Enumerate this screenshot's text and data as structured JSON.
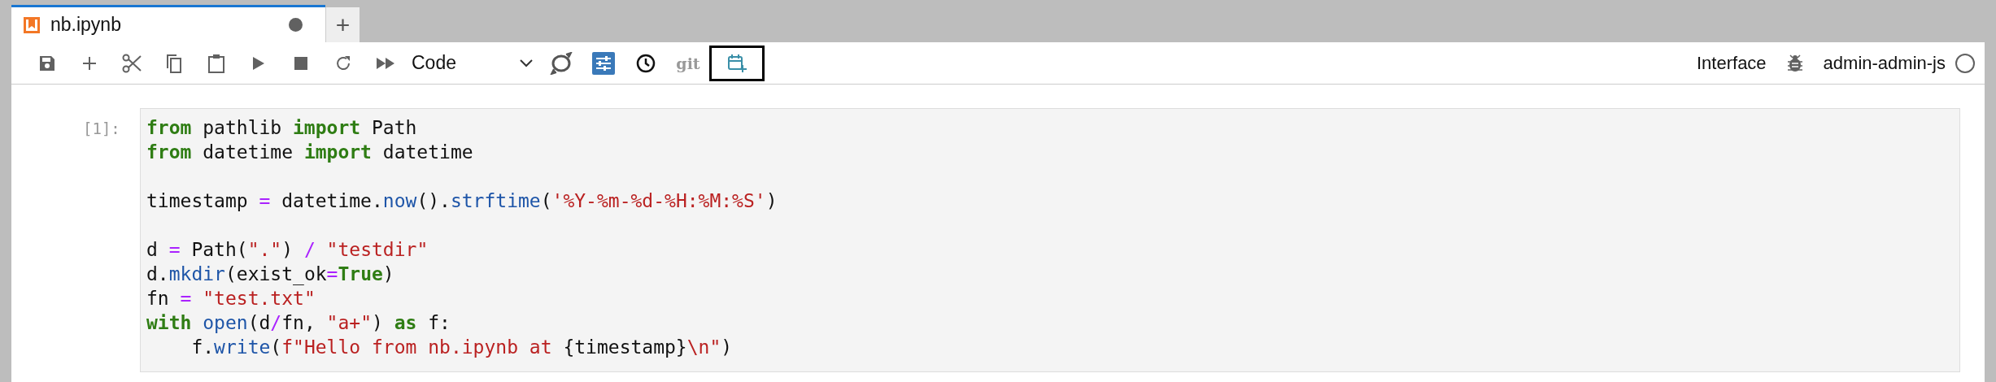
{
  "tabs": [
    {
      "title": "nb.ipynb",
      "modified": true,
      "selected": true
    }
  ],
  "new_tab_button": "+",
  "toolbar": {
    "buttons": [
      {
        "kind": "save",
        "selected": false
      },
      {
        "kind": "insert",
        "selected": false
      },
      {
        "kind": "cut",
        "selected": false
      },
      {
        "kind": "copy",
        "selected": false
      },
      {
        "kind": "paste",
        "selected": false
      },
      {
        "kind": "run",
        "selected": false
      },
      {
        "kind": "stop",
        "selected": false
      },
      {
        "kind": "restart",
        "selected": false
      },
      {
        "kind": "run-all",
        "selected": false
      }
    ],
    "cell_type": "Code",
    "extra_buttons": [
      {
        "kind": "swirl",
        "selected": false
      },
      {
        "kind": "sliders",
        "selected": false
      },
      {
        "kind": "clock",
        "selected": false
      },
      {
        "kind": "git",
        "label": "git",
        "selected": false
      },
      {
        "kind": "calendar",
        "selected": true
      }
    ],
    "interface_label": "Interface",
    "kernel": {
      "name": "admin-admin-js",
      "busy": false
    }
  },
  "cell": {
    "prompt": "[1]:",
    "lines": [
      [
        {
          "kind": "kw",
          "text": "from"
        },
        {
          "kind": "plain",
          "text": " pathlib "
        },
        {
          "kind": "kw",
          "text": "import"
        },
        {
          "kind": "plain",
          "text": " Path"
        }
      ],
      [
        {
          "kind": "kw",
          "text": "from"
        },
        {
          "kind": "plain",
          "text": " datetime "
        },
        {
          "kind": "kw",
          "text": "import"
        },
        {
          "kind": "plain",
          "text": " datetime"
        },
        {
          "kind": "blank-after"
        }
      ],
      [
        {
          "kind": "plain",
          "text": "timestamp "
        },
        {
          "kind": "op",
          "text": "="
        },
        {
          "kind": "plain",
          "text": " datetime."
        },
        {
          "kind": "fn",
          "text": "now"
        },
        {
          "kind": "plain",
          "text": "()."
        },
        {
          "kind": "fn",
          "text": "strftime"
        },
        {
          "kind": "plain",
          "text": "("
        },
        {
          "kind": "str",
          "text": "'%Y-%m-%d-%H:%M:%S'"
        },
        {
          "kind": "plain",
          "text": ")"
        },
        {
          "kind": "blank-after"
        }
      ],
      [
        {
          "kind": "plain",
          "text": "d "
        },
        {
          "kind": "op",
          "text": "="
        },
        {
          "kind": "plain",
          "text": " Path("
        },
        {
          "kind": "str",
          "text": "\".\""
        },
        {
          "kind": "plain",
          "text": ") "
        },
        {
          "kind": "op",
          "text": "/"
        },
        {
          "kind": "str",
          "text": " \"testdir\""
        }
      ],
      [
        {
          "kind": "plain",
          "text": "d."
        },
        {
          "kind": "fn",
          "text": "mkdir"
        },
        {
          "kind": "plain",
          "text": "(exist_ok"
        },
        {
          "kind": "op",
          "text": "="
        },
        {
          "kind": "kw",
          "text": "True"
        },
        {
          "kind": "plain",
          "text": ")"
        }
      ],
      [
        {
          "kind": "plain",
          "text": "fn "
        },
        {
          "kind": "op",
          "text": "="
        },
        {
          "kind": "str",
          "text": " \"test.txt\""
        }
      ],
      [
        {
          "kind": "kw",
          "text": "with"
        },
        {
          "kind": "fn",
          "text": " open"
        },
        {
          "kind": "plain",
          "text": "(d"
        },
        {
          "kind": "op",
          "text": "/"
        },
        {
          "kind": "plain",
          "text": "fn, "
        },
        {
          "kind": "str",
          "text": "\"a+\""
        },
        {
          "kind": "plain",
          "text": ") "
        },
        {
          "kind": "kw",
          "text": "as"
        },
        {
          "kind": "plain",
          "text": " f:"
        }
      ],
      [
        {
          "kind": "plain",
          "text": "    f."
        },
        {
          "kind": "fn",
          "text": "write"
        },
        {
          "kind": "plain",
          "text": "("
        },
        {
          "kind": "str",
          "text": "f\"Hello from nb.ipynb at "
        },
        {
          "kind": "plain",
          "text": "{timestamp}"
        },
        {
          "kind": "str",
          "text": "\\n\""
        },
        {
          "kind": "plain",
          "text": ")"
        }
      ]
    ]
  }
}
